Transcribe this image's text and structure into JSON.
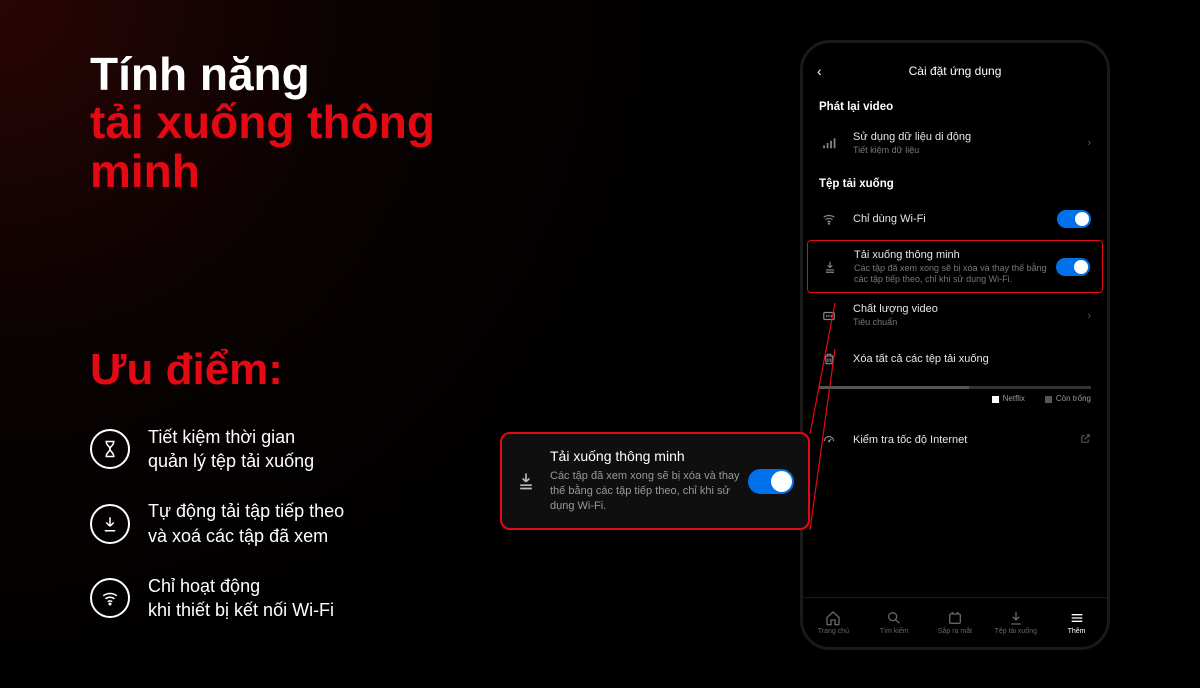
{
  "title": {
    "line1": "Tính năng",
    "line2": "tải xuống thông minh"
  },
  "advantages_heading": "Ưu điểm:",
  "features": [
    "Tiết kiệm thời gian\nquản lý tệp tải xuống",
    "Tự động tải tập tiếp theo\nvà xoá các tập đã xem",
    "Chỉ hoạt động\nkhi thiết bị kết nối Wi-Fi"
  ],
  "phone": {
    "header_title": "Cài đặt ứng dụng",
    "section_playback": "Phát lại video",
    "data_usage": {
      "title": "Sử dụng dữ liệu di động",
      "sub": "Tiết kiệm dữ liệu"
    },
    "section_downloads": "Tệp tải xuống",
    "wifi_only": "Chỉ dùng Wi-Fi",
    "smart_dl": {
      "title": "Tải xuống thông minh",
      "sub": "Các tập đã xem xong sẽ bị xóa và thay thế bằng các tập tiếp theo, chỉ khi sử dụng Wi-Fi."
    },
    "video_quality": {
      "title": "Chất lượng video",
      "sub": "Tiêu chuẩn"
    },
    "delete_all": "Xóa tất cả các tệp tải xuống",
    "storage": {
      "netflix": "Netflix",
      "free": "Còn trống"
    },
    "internet_check": "Kiểm tra tốc độ Internet",
    "nav": [
      "Trang chủ",
      "Tìm kiếm",
      "Sắp ra mắt",
      "Tệp tải xuống",
      "Thêm"
    ]
  },
  "callout": {
    "title": "Tải xuống thông minh",
    "sub": "Các tập đã xem xong sẽ bị xóa và thay thế bằng các tập tiếp theo, chỉ khi sử dụng Wi-Fi."
  }
}
